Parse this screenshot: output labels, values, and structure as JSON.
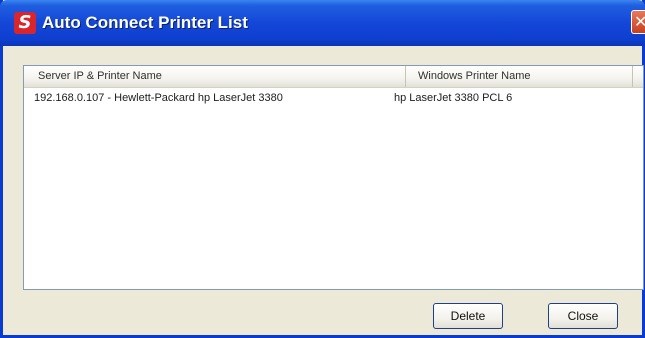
{
  "window": {
    "title": "Auto Connect Printer List",
    "app_icon_glyph": "S"
  },
  "titlebar": {
    "close_glyph": "✕"
  },
  "listview": {
    "columns": [
      "Server IP & Printer Name",
      "Windows Printer Name"
    ],
    "rows": [
      [
        "192.168.0.107 - Hewlett-Packard hp LaserJet 3380",
        "hp LaserJet 3380 PCL 6"
      ]
    ]
  },
  "buttons": {
    "delete_label": "Delete",
    "close_label": "Close"
  },
  "colors": {
    "titlebar": "#0e3fcf",
    "app_icon": "#d9262c",
    "close_button": "#c8401e"
  }
}
